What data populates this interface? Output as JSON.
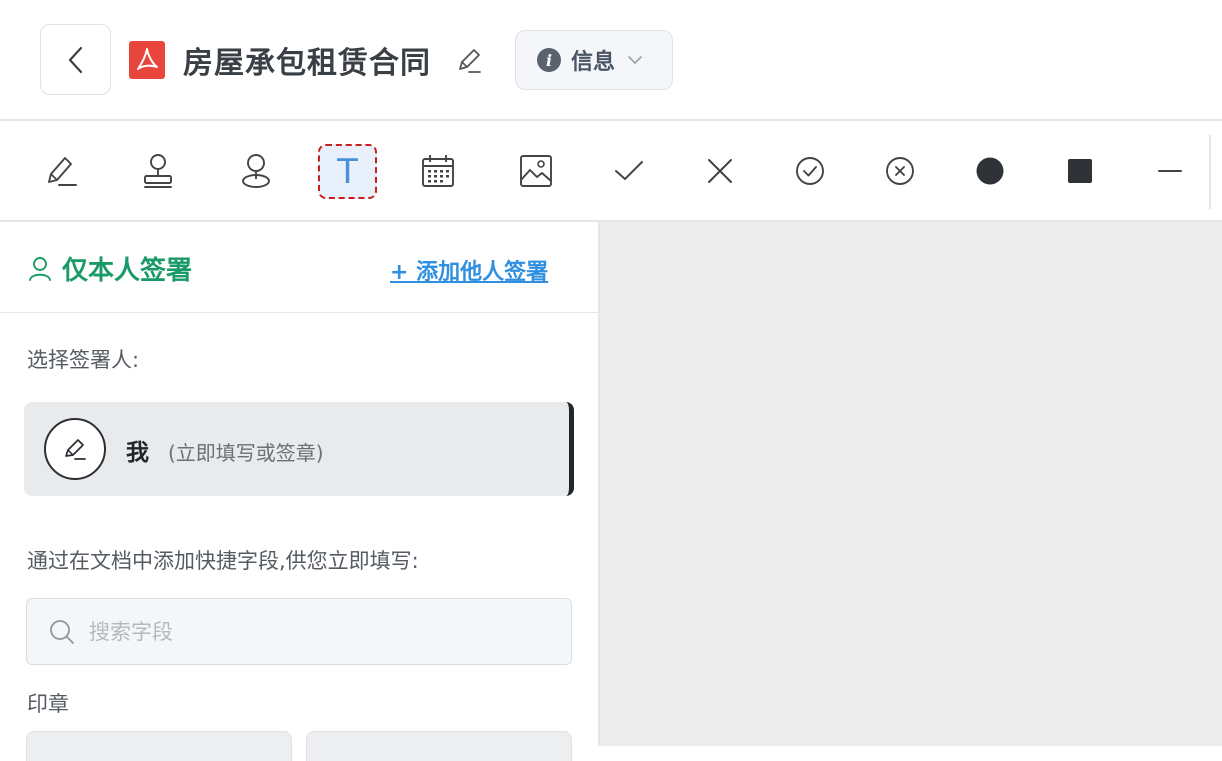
{
  "header": {
    "back_label": "back",
    "title": "房屋承包租赁合同",
    "info_label": "信息"
  },
  "toolbar": {
    "tools": [
      {
        "name": "signature",
        "icon": "pen-sign-icon"
      },
      {
        "name": "stamp",
        "icon": "stamp-icon"
      },
      {
        "name": "seal",
        "icon": "seal-icon"
      },
      {
        "name": "text",
        "icon": "text-icon",
        "active": true,
        "letter": "T"
      },
      {
        "name": "date",
        "icon": "calendar-icon"
      },
      {
        "name": "image",
        "icon": "image-icon"
      },
      {
        "name": "check",
        "icon": "check-icon"
      },
      {
        "name": "cross",
        "icon": "cross-icon"
      },
      {
        "name": "circle-check",
        "icon": "circle-check-icon"
      },
      {
        "name": "circle-cross",
        "icon": "circle-cross-icon"
      },
      {
        "name": "dot",
        "icon": "filled-circle-icon"
      },
      {
        "name": "square",
        "icon": "filled-square-icon"
      },
      {
        "name": "line",
        "icon": "line-icon"
      }
    ]
  },
  "panel": {
    "self_sign_label": "仅本人签署",
    "add_others_label": "+ 添加他人签署",
    "choose_signer_label": "选择签署人:",
    "signer": {
      "name": "我",
      "description": "(立即填写或签章)"
    },
    "quick_fields_label": "通过在文档中添加快捷字段,供您立即填写:",
    "search_placeholder": "搜索字段",
    "stamp_section_label": "印章"
  },
  "colors": {
    "accent_green": "#1a9a67",
    "link_blue": "#2f8fe0",
    "active_tool_border": "#c81e1e",
    "pdf_red": "#e8453c"
  }
}
